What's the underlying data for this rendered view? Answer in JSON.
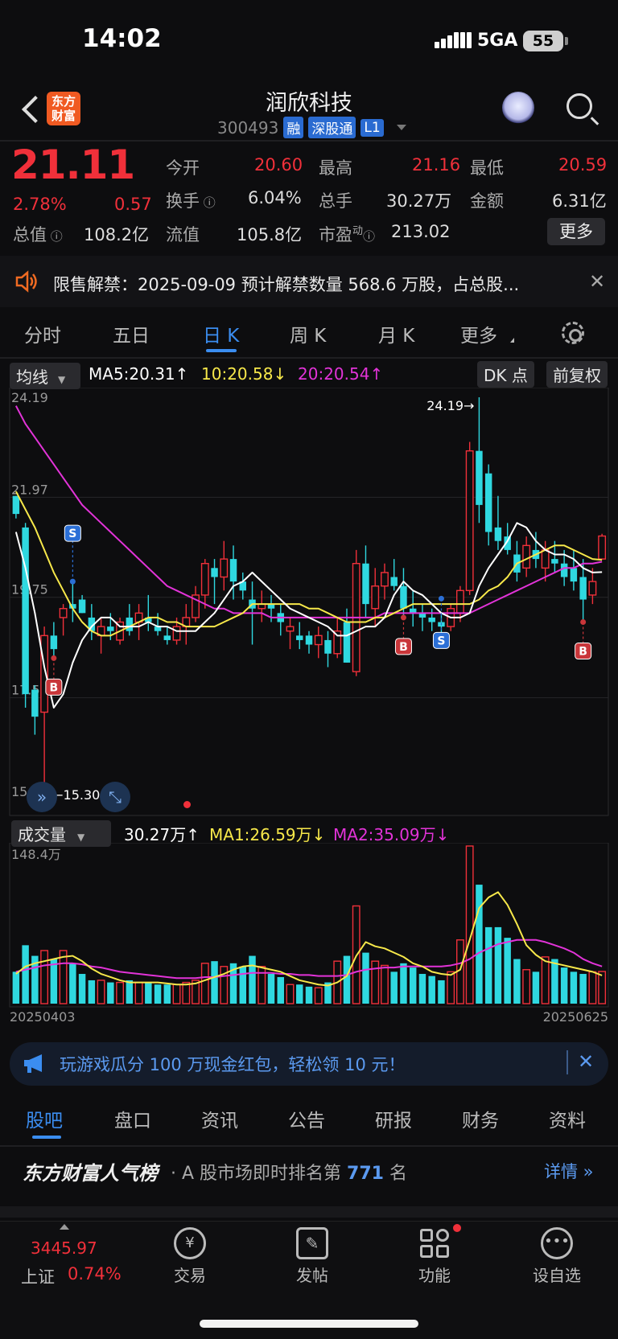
{
  "status": {
    "time": "14:02",
    "network": "5GA",
    "battery": "55"
  },
  "header": {
    "title": "润欣科技",
    "code": "300493",
    "tags": [
      "融",
      "深股通",
      "L1"
    ]
  },
  "quote": {
    "price": "21.11",
    "pct": "2.78%",
    "change": "0.57",
    "fields": [
      {
        "label": "今开",
        "value": "20.60",
        "color": "#f0303a"
      },
      {
        "label": "最高",
        "value": "21.16",
        "color": "#f0303a"
      },
      {
        "label": "最低",
        "value": "20.59",
        "color": "#f0303a"
      },
      {
        "label": "换手",
        "value": "6.04%",
        "color": "#dddddd"
      },
      {
        "label": "总手",
        "value": "30.27万",
        "color": "#dddddd"
      },
      {
        "label": "金额",
        "value": "6.31亿",
        "color": "#dddddd"
      },
      {
        "label": "总值",
        "value": "108.2亿",
        "color": "#dddddd"
      },
      {
        "label": "流值",
        "value": "105.8亿",
        "color": "#dddddd"
      },
      {
        "label": "市盈",
        "value": "213.02",
        "color": "#dddddd",
        "sup": "动"
      }
    ],
    "more": "更多"
  },
  "notice": {
    "text": "限售解禁：2025-09-09 预计解禁数量 568.6 万股，占总股..."
  },
  "period_tabs": [
    "分时",
    "五日",
    "日 K",
    "周 K",
    "月 K",
    "更多"
  ],
  "active_tab": "日 K",
  "ma_bar": {
    "select": "均线",
    "ma5": "MA5:20.31",
    "ma10": "10:20.58",
    "ma20": "20:20.54",
    "dk": "DK 点",
    "adjust": "前复权"
  },
  "vol_bar": {
    "select": "成交量",
    "vol": "30.27万",
    "ma1": "MA1:26.59万",
    "ma2": "MA2:35.09万"
  },
  "colors": {
    "up": "#f0303a",
    "down": "#2fd8e0",
    "ma5": "#ffffff",
    "ma10": "#f7e84a",
    "ma20": "#e233d8",
    "accent": "#3b8df0"
  },
  "chart_data": {
    "type": "candlestick",
    "y_ticks": [
      "24.19",
      "21.97",
      "19.75",
      "17.52",
      "15.30"
    ],
    "ylim": [
      15.3,
      24.19
    ],
    "annotations": {
      "high": "24.19→",
      "low": "←15.30"
    },
    "signals": [
      "S",
      "B",
      "S",
      "B",
      "B"
    ],
    "x_start": "20250403",
    "x_end": "20250625",
    "vol_max": "148.4万",
    "candles": [
      [
        22.0,
        22.0,
        21.5,
        21.6
      ],
      [
        21.3,
        21.4,
        17.3,
        17.6
      ],
      [
        17.7,
        17.8,
        16.7,
        17.1
      ],
      [
        17.2,
        19.1,
        15.3,
        18.9
      ],
      [
        18.9,
        19.2,
        18.4,
        18.6
      ],
      [
        19.3,
        19.6,
        18.9,
        19.5
      ],
      [
        19.6,
        20.1,
        19.2,
        19.5
      ],
      [
        19.7,
        19.8,
        19.4,
        19.4
      ],
      [
        19.3,
        19.6,
        18.8,
        19.0
      ],
      [
        18.9,
        19.3,
        18.5,
        19.1
      ],
      [
        19.1,
        19.4,
        18.8,
        19.0
      ],
      [
        18.8,
        19.3,
        18.7,
        19.2
      ],
      [
        19.3,
        19.6,
        18.9,
        19.0
      ],
      [
        19.2,
        19.6,
        18.8,
        19.4
      ],
      [
        19.3,
        19.8,
        19.0,
        19.2
      ],
      [
        19.1,
        19.4,
        18.9,
        19.0
      ],
      [
        18.9,
        19.1,
        18.7,
        18.8
      ],
      [
        18.8,
        19.3,
        18.7,
        19.1
      ],
      [
        19.1,
        19.6,
        18.7,
        19.3
      ],
      [
        19.3,
        20.0,
        19.2,
        19.8
      ],
      [
        19.8,
        20.6,
        19.5,
        20.5
      ],
      [
        20.4,
        20.6,
        19.6,
        20.2
      ],
      [
        20.2,
        21.0,
        19.9,
        20.6
      ],
      [
        20.6,
        20.9,
        19.7,
        20.1
      ],
      [
        20.1,
        20.3,
        19.7,
        19.9
      ],
      [
        19.7,
        20.1,
        18.7,
        19.5
      ],
      [
        19.5,
        19.9,
        19.2,
        19.6
      ],
      [
        19.6,
        19.8,
        19.2,
        19.5
      ],
      [
        19.4,
        19.6,
        18.9,
        19.2
      ],
      [
        19.0,
        19.3,
        18.6,
        19.1
      ],
      [
        18.9,
        19.2,
        18.6,
        18.8
      ],
      [
        18.9,
        19.0,
        18.5,
        18.7
      ],
      [
        18.7,
        19.1,
        18.4,
        18.9
      ],
      [
        18.8,
        19.0,
        18.2,
        18.5
      ],
      [
        18.5,
        19.3,
        18.4,
        19.0
      ],
      [
        19.2,
        19.5,
        18.3,
        18.3
      ],
      [
        18.1,
        20.8,
        18.0,
        20.5
      ],
      [
        20.5,
        20.9,
        19.3,
        19.6
      ],
      [
        19.5,
        20.4,
        19.1,
        20.0
      ],
      [
        20.0,
        20.5,
        19.7,
        20.3
      ],
      [
        20.2,
        20.6,
        19.9,
        20.0
      ],
      [
        20.0,
        20.4,
        19.3,
        19.5
      ],
      [
        19.5,
        19.9,
        19.1,
        19.4
      ],
      [
        19.4,
        19.6,
        19.0,
        19.3
      ],
      [
        19.3,
        19.5,
        19.0,
        19.2
      ],
      [
        19.2,
        19.4,
        18.9,
        19.1
      ],
      [
        19.1,
        19.6,
        19.0,
        19.5
      ],
      [
        19.4,
        20.0,
        19.2,
        19.9
      ],
      [
        19.9,
        23.2,
        19.8,
        23.0
      ],
      [
        23.0,
        24.19,
        21.4,
        21.8
      ],
      [
        22.5,
        22.7,
        20.9,
        21.2
      ],
      [
        21.3,
        22.0,
        20.8,
        21.0
      ],
      [
        21.1,
        21.4,
        20.7,
        20.8
      ],
      [
        20.7,
        21.0,
        20.1,
        20.3
      ],
      [
        20.4,
        21.1,
        20.2,
        20.9
      ],
      [
        20.8,
        21.2,
        20.4,
        20.6
      ],
      [
        20.4,
        21.0,
        20.1,
        20.8
      ],
      [
        20.6,
        21.0,
        20.3,
        20.5
      ],
      [
        20.5,
        20.8,
        20.0,
        20.2
      ],
      [
        20.4,
        20.8,
        19.9,
        20.1
      ],
      [
        20.2,
        20.6,
        19.2,
        19.7
      ],
      [
        19.8,
        20.4,
        19.6,
        20.1
      ],
      [
        20.6,
        21.16,
        20.59,
        21.11
      ]
    ],
    "ma5": [
      21.2,
      20.4,
      19.4,
      18.2,
      17.3,
      17.6,
      18.3,
      18.8,
      19.1,
      19.3,
      19.3,
      19.1,
      19.1,
      19.1,
      19.2,
      19.1,
      19.1,
      19.0,
      19.0,
      19.0,
      19.2,
      19.4,
      19.7,
      20.0,
      20.1,
      20.3,
      20.1,
      19.9,
      19.7,
      19.5,
      19.4,
      19.3,
      19.2,
      19.1,
      18.9,
      18.9,
      19.0,
      19.1,
      19.1,
      19.3,
      19.8,
      20.1,
      19.9,
      19.8,
      19.6,
      19.4,
      19.3,
      19.3,
      19.4,
      20.0,
      20.4,
      20.7,
      21.0,
      21.4,
      21.3,
      21.0,
      20.8,
      20.7,
      20.7,
      20.6,
      20.4,
      20.3,
      20.31
    ],
    "ma10": [
      22.1,
      21.7,
      21.3,
      20.8,
      20.3,
      19.9,
      19.5,
      19.2,
      19.0,
      18.9,
      18.9,
      19.0,
      19.1,
      19.2,
      19.3,
      19.3,
      19.2,
      19.2,
      19.1,
      19.1,
      19.1,
      19.1,
      19.2,
      19.3,
      19.4,
      19.6,
      19.6,
      19.6,
      19.6,
      19.6,
      19.6,
      19.5,
      19.5,
      19.4,
      19.3,
      19.2,
      19.2,
      19.2,
      19.3,
      19.3,
      19.4,
      19.5,
      19.6,
      19.6,
      19.6,
      19.6,
      19.6,
      19.6,
      19.6,
      19.7,
      19.9,
      20.0,
      20.2,
      20.5,
      20.6,
      20.7,
      20.8,
      20.9,
      20.9,
      20.8,
      20.7,
      20.6,
      20.58
    ],
    "ma20": [
      24.0,
      23.6,
      23.3,
      23.0,
      22.7,
      22.4,
      22.1,
      21.8,
      21.6,
      21.4,
      21.2,
      21.0,
      20.8,
      20.6,
      20.4,
      20.2,
      20.0,
      19.9,
      19.8,
      19.7,
      19.6,
      19.5,
      19.5,
      19.4,
      19.4,
      19.4,
      19.4,
      19.3,
      19.3,
      19.3,
      19.3,
      19.3,
      19.3,
      19.3,
      19.3,
      19.3,
      19.3,
      19.3,
      19.3,
      19.4,
      19.4,
      19.4,
      19.4,
      19.4,
      19.4,
      19.4,
      19.4,
      19.4,
      19.4,
      19.5,
      19.6,
      19.7,
      19.8,
      19.9,
      20.0,
      20.1,
      20.2,
      20.3,
      20.4,
      20.4,
      20.5,
      20.5,
      20.54
    ],
    "volume": [
      30,
      55,
      45,
      50,
      42,
      50,
      38,
      28,
      22,
      22,
      20,
      20,
      22,
      20,
      20,
      18,
      18,
      18,
      20,
      22,
      38,
      40,
      35,
      38,
      35,
      45,
      35,
      28,
      25,
      18,
      18,
      16,
      15,
      20,
      40,
      45,
      92,
      48,
      40,
      36,
      30,
      38,
      34,
      28,
      26,
      22,
      30,
      60,
      148.4,
      112,
      72,
      72,
      62,
      42,
      32,
      30,
      44,
      42,
      34,
      30,
      28,
      30,
      30.27
    ],
    "vol_ma1": [
      28,
      35,
      38,
      40,
      42,
      44,
      45,
      40,
      33,
      28,
      25,
      22,
      20,
      20,
      20,
      20,
      19,
      18,
      18,
      19,
      22,
      25,
      28,
      32,
      35,
      36,
      34,
      32,
      30,
      26,
      22,
      20,
      18,
      17,
      20,
      26,
      45,
      58,
      54,
      52,
      48,
      44,
      38,
      35,
      30,
      28,
      27,
      32,
      60,
      90,
      100,
      105,
      93,
      75,
      55,
      46,
      40,
      38,
      36,
      34,
      32,
      30,
      26.59
    ],
    "vol_ma2": [
      30,
      32,
      34,
      36,
      37,
      38,
      38,
      37,
      35,
      34,
      32,
      30,
      29,
      28,
      27,
      26,
      25,
      24,
      24,
      24,
      25,
      25,
      26,
      27,
      28,
      29,
      29,
      29,
      28,
      28,
      27,
      27,
      26,
      26,
      26,
      27,
      30,
      32,
      33,
      34,
      34,
      35,
      35,
      35,
      35,
      35,
      36,
      38,
      42,
      48,
      52,
      56,
      58,
      60,
      60,
      60,
      58,
      55,
      52,
      48,
      42,
      38,
      35.09
    ]
  },
  "promo": {
    "text": "玩游戏瓜分 100 万现金红包，轻松领 10 元！"
  },
  "bottom_tabs": [
    "股吧",
    "盘口",
    "资讯",
    "公告",
    "研报",
    "财务",
    "资料"
  ],
  "rank": {
    "title": "东方财富人气榜",
    "desc_prefix": "· A 股市场即时排名第",
    "num": "771",
    "desc_suffix": "名",
    "detail": "详情"
  },
  "dock": {
    "index_value": "3445.97",
    "index_name": "上证",
    "index_pct": "0.74%",
    "items": [
      "交易",
      "发帖",
      "功能",
      "设自选"
    ]
  }
}
